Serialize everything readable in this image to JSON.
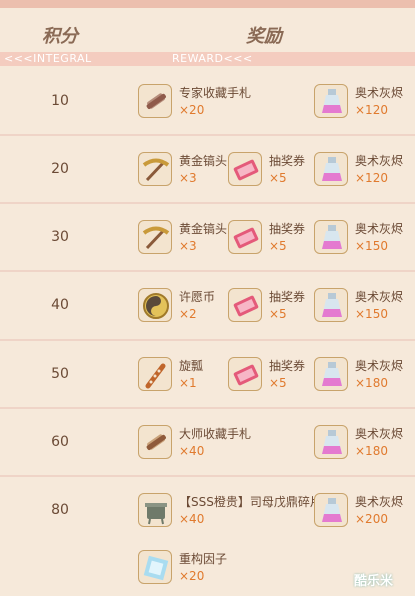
{
  "header": {
    "score_title": "积分",
    "reward_title": "奖励",
    "score_sub": "<<<INTEGRAL",
    "reward_sub": "REWARD<<<"
  },
  "rows": [
    {
      "score": "10",
      "items": [
        {
          "name": "专家收藏手札",
          "qty": "×20",
          "icon": "scroll-icon"
        },
        {
          "name": "奥术灰烬",
          "qty": "×120",
          "icon": "potion-icon"
        }
      ]
    },
    {
      "score": "20",
      "items": [
        {
          "name": "黄金镐头",
          "qty": "×3",
          "icon": "pickaxe-icon"
        },
        {
          "name": "抽奖券",
          "qty": "×5",
          "icon": "ticket-icon"
        },
        {
          "name": "奥术灰烬",
          "qty": "×120",
          "icon": "potion-icon"
        }
      ]
    },
    {
      "score": "30",
      "items": [
        {
          "name": "黄金镐头",
          "qty": "×3",
          "icon": "pickaxe-icon"
        },
        {
          "name": "抽奖券",
          "qty": "×5",
          "icon": "ticket-icon"
        },
        {
          "name": "奥术灰烬",
          "qty": "×150",
          "icon": "potion-icon"
        }
      ]
    },
    {
      "score": "40",
      "items": [
        {
          "name": "许愿币",
          "qty": "×2",
          "icon": "coin-icon"
        },
        {
          "name": "抽奖券",
          "qty": "×5",
          "icon": "ticket-icon"
        },
        {
          "name": "奥术灰烬",
          "qty": "×150",
          "icon": "potion-icon"
        }
      ]
    },
    {
      "score": "50",
      "items": [
        {
          "name": "旋瓢",
          "qty": "×1",
          "icon": "firework-icon"
        },
        {
          "name": "抽奖券",
          "qty": "×5",
          "icon": "ticket-icon"
        },
        {
          "name": "奥术灰烬",
          "qty": "×180",
          "icon": "potion-icon"
        }
      ]
    },
    {
      "score": "60",
      "items": [
        {
          "name": "大师收藏手札",
          "qty": "×40",
          "icon": "scroll-icon"
        },
        {
          "name": "奥术灰烬",
          "qty": "×180",
          "icon": "potion-icon"
        }
      ]
    },
    {
      "score": "80",
      "items": [
        {
          "name": "【SSS橙贵】司母戊鼎碎片",
          "qty": "×40",
          "icon": "cauldron-icon"
        },
        {
          "name": "奥术灰烬",
          "qty": "×200",
          "icon": "potion-icon"
        },
        {
          "name": "重构因子",
          "qty": "×20",
          "icon": "crystal-icon"
        }
      ]
    }
  ],
  "watermark": "酷乐米"
}
